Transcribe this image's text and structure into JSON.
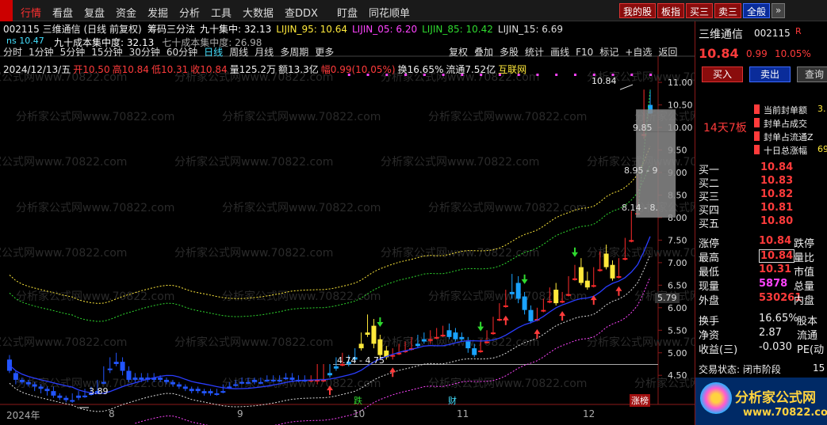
{
  "menu": {
    "items": [
      "行情",
      "看盘",
      "复盘",
      "资金",
      "发掘",
      "分析",
      "工具",
      "大数据",
      "查DDX",
      "盯盘",
      "同花顺单"
    ],
    "active": "行情",
    "right_buttons": [
      {
        "label": "我的股",
        "kind": "red"
      },
      {
        "label": "板指",
        "kind": "red"
      },
      {
        "label": "买三",
        "kind": "red"
      },
      {
        "label": "卖三",
        "kind": "red"
      },
      {
        "label": "全般",
        "kind": "blue"
      },
      {
        "label": "»",
        "kind": "gray"
      }
    ]
  },
  "stock": {
    "code": "002115",
    "name": "三维通信",
    "mode": "(日线 前复权)",
    "price": "10.84",
    "change": "0.99",
    "change_pct": "10.05%",
    "r_badge": "R"
  },
  "indicators_row1": [
    {
      "label": "筹码三分法",
      "color": "#ffffff"
    },
    {
      "label": "九十集中: 32.13",
      "color": "#ffffff"
    },
    {
      "label": "LIJIN_95: 10.64",
      "color": "#ffe93b"
    },
    {
      "label": "LIJIN_05: 6.20",
      "color": "#ff44ff"
    },
    {
      "label": "LIJIN_85: 10.42",
      "color": "#2fd92f"
    },
    {
      "label": "LIJIN_15: 6.69",
      "color": "#dddddd"
    }
  ],
  "indicators_row2": [
    {
      "label": "九十成本集中度: 32.13",
      "color": "#ffffff"
    },
    {
      "label": "七十成本集中度: 26.98",
      "color": "#aaaaaa"
    }
  ],
  "small_label": "ns 10.47",
  "ohlc_info": {
    "date": "2024/12/13/五",
    "open": "开10.50",
    "high": "高10.84",
    "low": "低10.31",
    "close": "收10.84",
    "volume": "量125.2万",
    "amount": "额13.3亿",
    "amplitude": "幅0.99(10.05%)",
    "turnover": "换16.65%",
    "float": "流通7.52亿",
    "concept": "互联网"
  },
  "periods": [
    "分时",
    "1分钟",
    "5分钟",
    "15分钟",
    "30分钟",
    "60分钟",
    "日线",
    "周线",
    "月线",
    "多周期",
    "更多"
  ],
  "active_period": "日线",
  "chart_toolbar": [
    "复权",
    "叠加",
    "多股",
    "统计",
    "画线",
    "F10",
    "标记",
    "+自选",
    "返回"
  ],
  "watermark": "分析家公式网www.70822.com",
  "logo": {
    "text": "分析家公式网",
    "url_text": "www.70822.com"
  },
  "x_axis": {
    "year_label": "2024年",
    "months": [
      "8",
      "9",
      "10",
      "11",
      "12"
    ]
  },
  "axis_badges": [
    {
      "label": "跌",
      "color": "#2fd92f"
    },
    {
      "label": "财",
      "color": "#44e0ff"
    },
    {
      "label": "涨榜",
      "color": "#ff3b3b"
    }
  ],
  "chart_annotations": {
    "high_mark": "10.84",
    "low_mark": "3.89",
    "gap_range": "4.74 - 4.75",
    "price_tag": "5.79",
    "chip_labels": [
      "9.85",
      "8.95 - 9",
      "8.14 - 8."
    ]
  },
  "chart_data": {
    "type": "candlestick",
    "y_axis_ticks": [
      11.0,
      10.5,
      10.0,
      9.5,
      9.0,
      8.5,
      8.0,
      7.5,
      7.0,
      6.5,
      6.0,
      5.5,
      5.0,
      4.5
    ],
    "ylim": [
      4.1,
      11.3
    ],
    "candles": [
      [
        4.85,
        4.95,
        4.6,
        4.55
      ],
      [
        4.55,
        4.6,
        4.4,
        4.3
      ],
      [
        4.4,
        4.45,
        4.35,
        4.3
      ],
      [
        4.35,
        4.4,
        4.3,
        4.25
      ],
      [
        4.3,
        4.35,
        4.25,
        4.15
      ],
      [
        4.25,
        4.3,
        4.2,
        4.1
      ],
      [
        4.2,
        4.25,
        4.15,
        4.05
      ],
      [
        4.15,
        4.25,
        4.05,
        4.0
      ],
      [
        4.05,
        4.1,
        4.0,
        3.95
      ],
      [
        4.0,
        4.05,
        3.95,
        3.9
      ],
      [
        3.95,
        4.1,
        3.95,
        3.89
      ],
      [
        4.05,
        4.15,
        4.0,
        3.95
      ],
      [
        4.05,
        4.2,
        4.05,
        4.0
      ],
      [
        4.1,
        4.25,
        4.1,
        4.05
      ],
      [
        4.15,
        4.4,
        4.15,
        4.1
      ],
      [
        4.35,
        4.7,
        4.35,
        4.3
      ],
      [
        4.65,
        4.9,
        4.65,
        4.55
      ],
      [
        4.8,
        5.0,
        4.75,
        4.7
      ],
      [
        4.8,
        4.9,
        4.6,
        4.5
      ],
      [
        4.6,
        4.7,
        4.4,
        4.35
      ],
      [
        4.45,
        4.55,
        4.4,
        4.35
      ],
      [
        4.45,
        4.55,
        4.4,
        4.35
      ],
      [
        4.45,
        4.55,
        4.4,
        4.35
      ],
      [
        4.45,
        4.55,
        4.4,
        4.35
      ],
      [
        4.45,
        4.5,
        4.4,
        4.35
      ],
      [
        4.4,
        4.45,
        4.35,
        4.3
      ],
      [
        4.35,
        4.4,
        4.3,
        4.25
      ],
      [
        4.3,
        4.35,
        4.25,
        4.2
      ],
      [
        4.25,
        4.3,
        4.2,
        4.15
      ],
      [
        4.2,
        4.25,
        4.15,
        4.1
      ],
      [
        4.2,
        4.25,
        4.15,
        4.1
      ],
      [
        4.15,
        4.2,
        4.1,
        4.05
      ],
      [
        4.15,
        4.2,
        4.1,
        4.05
      ],
      [
        4.1,
        4.2,
        4.1,
        4.05
      ],
      [
        4.15,
        4.3,
        4.15,
        4.1
      ],
      [
        4.25,
        4.35,
        4.25,
        4.2
      ],
      [
        4.3,
        4.4,
        4.3,
        4.25
      ],
      [
        4.35,
        4.45,
        4.35,
        4.3
      ],
      [
        4.35,
        4.45,
        4.35,
        4.3
      ],
      [
        4.4,
        4.45,
        4.35,
        4.3
      ],
      [
        4.35,
        4.45,
        4.35,
        4.3
      ],
      [
        4.4,
        4.5,
        4.4,
        4.35
      ],
      [
        4.4,
        4.5,
        4.4,
        4.35
      ],
      [
        4.4,
        4.5,
        4.4,
        4.35
      ],
      [
        4.45,
        4.55,
        4.45,
        4.4
      ],
      [
        4.45,
        4.55,
        4.4,
        4.35
      ],
      [
        4.4,
        4.5,
        4.4,
        4.35
      ],
      [
        4.4,
        4.5,
        4.4,
        4.35
      ],
      [
        4.4,
        4.5,
        4.4,
        4.35
      ],
      [
        4.4,
        4.75,
        4.4,
        4.3
      ],
      [
        4.4,
        4.75,
        4.4,
        4.35
      ],
      [
        4.55,
        4.75,
        4.5,
        4.45
      ],
      [
        4.7,
        4.9,
        4.65,
        4.6
      ],
      [
        4.75,
        5.0,
        4.75,
        4.7
      ],
      [
        4.8,
        4.95,
        4.75,
        4.7
      ],
      [
        4.9,
        5.1,
        4.85,
        4.8
      ],
      [
        5.2,
        5.45,
        5.1,
        5.05
      ],
      [
        5.45,
        5.85,
        5.4,
        5.35
      ],
      [
        5.6,
        5.75,
        5.2,
        5.1
      ],
      [
        5.3,
        5.4,
        4.95,
        4.85
      ],
      [
        5.05,
        5.15,
        4.9,
        4.85
      ],
      [
        4.95,
        5.1,
        4.95,
        4.85
      ],
      [
        5.0,
        5.2,
        5.0,
        4.95
      ],
      [
        5.05,
        5.25,
        5.05,
        5.0
      ],
      [
        5.1,
        5.35,
        5.1,
        5.05
      ],
      [
        5.2,
        5.4,
        5.15,
        5.1
      ],
      [
        5.3,
        5.45,
        5.25,
        5.2
      ],
      [
        5.3,
        5.5,
        5.3,
        5.2
      ],
      [
        5.35,
        5.55,
        5.35,
        5.3
      ],
      [
        5.4,
        5.6,
        5.4,
        5.35
      ],
      [
        5.5,
        5.65,
        5.35,
        5.3
      ],
      [
        5.45,
        5.55,
        5.3,
        5.25
      ],
      [
        5.35,
        5.45,
        5.3,
        5.25
      ],
      [
        5.25,
        5.35,
        5.1,
        5.0
      ],
      [
        5.1,
        5.2,
        4.95,
        4.9
      ],
      [
        5.05,
        5.3,
        5.05,
        5.0
      ],
      [
        5.25,
        5.5,
        5.25,
        5.2
      ],
      [
        5.45,
        5.8,
        5.45,
        5.4
      ],
      [
        5.75,
        6.1,
        5.75,
        5.7
      ],
      [
        6.05,
        6.4,
        6.05,
        6.0
      ],
      [
        6.35,
        6.75,
        6.3,
        6.2
      ],
      [
        6.55,
        6.7,
        6.2,
        6.1
      ],
      [
        6.25,
        6.35,
        5.95,
        5.85
      ],
      [
        5.95,
        6.05,
        5.7,
        5.65
      ],
      [
        5.75,
        6.0,
        5.75,
        5.7
      ],
      [
        5.95,
        6.2,
        5.95,
        5.9
      ],
      [
        6.15,
        6.45,
        6.15,
        6.1
      ],
      [
        6.4,
        6.55,
        6.1,
        6.05
      ],
      [
        6.15,
        6.35,
        6.15,
        6.1
      ],
      [
        6.3,
        6.7,
        6.3,
        6.25
      ],
      [
        6.65,
        6.95,
        6.65,
        6.6
      ],
      [
        6.9,
        7.1,
        6.55,
        6.5
      ],
      [
        6.6,
        6.8,
        6.45,
        6.4
      ],
      [
        6.5,
        6.9,
        6.5,
        6.45
      ],
      [
        6.85,
        7.25,
        6.85,
        6.8
      ],
      [
        7.2,
        7.4,
        6.9,
        6.85
      ],
      [
        6.95,
        7.05,
        6.65,
        6.6
      ],
      [
        6.7,
        7.1,
        6.7,
        6.65
      ],
      [
        7.1,
        7.55,
        7.1,
        7.05
      ],
      [
        7.5,
        8.15,
        7.5,
        7.45
      ],
      [
        8.1,
        8.95,
        8.1,
        8.05
      ],
      [
        9.85,
        10.84,
        9.85,
        9.75
      ],
      [
        10.5,
        10.84,
        10.31,
        10.3
      ]
    ],
    "series": [
      {
        "name": "LIJIN_95",
        "color": "#ffe93b"
      },
      {
        "name": "LIJIN_05",
        "color": "#ff44ff"
      },
      {
        "name": "LIJIN_85",
        "color": "#2fd92f"
      },
      {
        "name": "LIJIN_15",
        "color": "#dddddd"
      }
    ]
  },
  "quote": {
    "name": "三维通信",
    "code": "002115",
    "price": "10.84",
    "change": "0.99",
    "change_pct": "10.05%",
    "buy_btn": "买入",
    "sell_btn": "卖出",
    "query_btn": "查询",
    "board_tag": "14天7板",
    "seal_info": [
      "当前封单额",
      "封单占成交",
      "封单占流通Z",
      "十日总涨幅"
    ],
    "seal_values": [
      "3.",
      "",
      "",
      "69"
    ],
    "bids": [
      {
        "label": "买一",
        "price": "10.84"
      },
      {
        "label": "买二",
        "price": "10.83"
      },
      {
        "label": "买三",
        "price": "10.82"
      },
      {
        "label": "买四",
        "price": "10.81"
      },
      {
        "label": "买五",
        "price": "10.80"
      }
    ],
    "stats": [
      {
        "label": "涨停",
        "value": "10.84",
        "label2": "跌停"
      },
      {
        "label": "最高",
        "value": "10.84",
        "label2": "量比"
      },
      {
        "label": "最低",
        "value": "10.31",
        "label2": "市值"
      },
      {
        "label": "现量",
        "value": "5878",
        "label2": "总量"
      },
      {
        "label": "外盘",
        "value": "530261",
        "label2": "内盘"
      }
    ],
    "fin": [
      {
        "label": "换手",
        "value": "16.65%",
        "label2": "股本"
      },
      {
        "label": "净资",
        "value": "2.87",
        "label2": "流通"
      },
      {
        "label": "收益(三)",
        "value": "-0.030",
        "label2": "PE(动"
      }
    ],
    "trade_status": "交易状态: 闭市阶段",
    "trade_time": "15"
  }
}
